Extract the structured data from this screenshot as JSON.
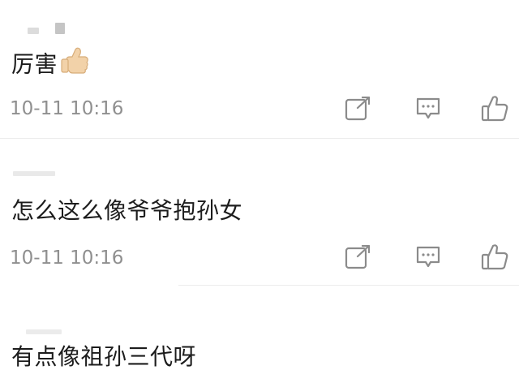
{
  "comments": [
    {
      "text": "厉害",
      "emoji_icon": "thumbs-up-emoji-icon",
      "timestamp": "10-11 10:16",
      "actions": [
        "share-icon",
        "reply-icon",
        "like-icon"
      ]
    },
    {
      "text": "怎么这么像爷爷抱孙女",
      "timestamp": "10-11 10:16",
      "actions": [
        "share-icon",
        "reply-icon",
        "like-icon"
      ]
    },
    {
      "text": "有点像祖孙三代呀"
    }
  ],
  "colors": {
    "text": "#1c1c1c",
    "meta": "#8f8f8f",
    "icon": "#8b8b8b",
    "divider": "#ececec"
  }
}
